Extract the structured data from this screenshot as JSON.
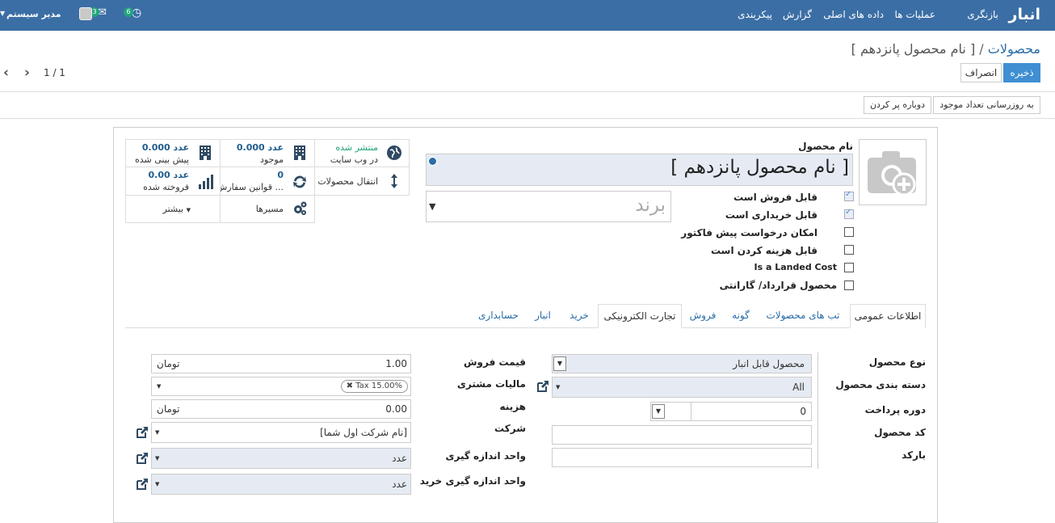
{
  "topbar": {
    "app_title": "انبار",
    "menu": [
      "بازنگری",
      "عملیات ها",
      "داده های اصلی",
      "گزارش",
      "پیکربندی"
    ],
    "user_name": "مدیر سیستم",
    "messages_count": "3",
    "activities_count": "6"
  },
  "breadcrumb": {
    "parent": "محصولات",
    "separator": "/",
    "current": "[ نام محصول پانزدهم ]"
  },
  "actions": {
    "save": "ذخیره",
    "discard": "انصراف"
  },
  "pager": {
    "text": "1 / 1"
  },
  "toolbar": {
    "update_qty": "به روزرسانی تعداد موجود",
    "refill": "دوباره پر کردن"
  },
  "smart": {
    "published_status": "منتشر شده",
    "published_sub": "در وب سایت",
    "onhand_value": "0.000 عدد",
    "onhand_label": "موجود",
    "forecast_value": "0.000 عدد",
    "forecast_label": "پیش بینی شده",
    "transfers_label": "انتقال محصولات",
    "rules_value": "0",
    "rules_label": "قوانین سفارش ...",
    "sold_value": "0.00 عدد",
    "sold_label": "فروخته شده",
    "routes_label": "مسیرها",
    "more_label": "بیشتر"
  },
  "product": {
    "name_label": "نام محصول",
    "name": "[ نام محصول پانزدهم ]",
    "brand_placeholder": "برند"
  },
  "checkboxes": [
    {
      "label": "قابل فروش است",
      "checked": true
    },
    {
      "label": "قابل خریداری است",
      "checked": true
    },
    {
      "label": "امکان درخواست پیش فاکتور",
      "checked": false
    },
    {
      "label": "قابل هزینه کردن است",
      "checked": false
    },
    {
      "label": "Is a Landed Cost",
      "checked": false
    },
    {
      "label": "محصول قرارداد/ گارانتی",
      "checked": false
    }
  ],
  "tabs": [
    "اطلاعات عمومی",
    "تب های محصولات",
    "گونه",
    "فروش",
    "تجارت الکترونیکی",
    "خرید",
    "انبار",
    "حسابداری"
  ],
  "general": {
    "type_label": "نوع محصول",
    "type_value": "محصول قابل انبار",
    "category_label": "دسته بندی محصول",
    "category_value": "All",
    "payment_label": "دوره پرداخت",
    "payment_value": "0",
    "code_label": "کد محصول",
    "barcode_label": "بارکد",
    "price_label": "قیمت فروش",
    "price_value": "1.00",
    "price_currency": "تومان",
    "tax_label": "مالیات مشتری",
    "tax_tag": "Tax 15.00%",
    "cost_label": "هزینه",
    "cost_value": "0.00",
    "cost_currency": "تومان",
    "company_label": "شرکت",
    "company_value": "[نام شرکت اول شما]",
    "uom_label": "واحد اندازه گیری",
    "uom_value": "عدد",
    "puom_label": "واحد اندازه گیری خرید",
    "puom_value": "عدد"
  },
  "colors": {
    "topbar": "#3b6ea5",
    "primary": "#3f8fd2",
    "link": "#2a6ca8",
    "published": "#21a47d"
  }
}
